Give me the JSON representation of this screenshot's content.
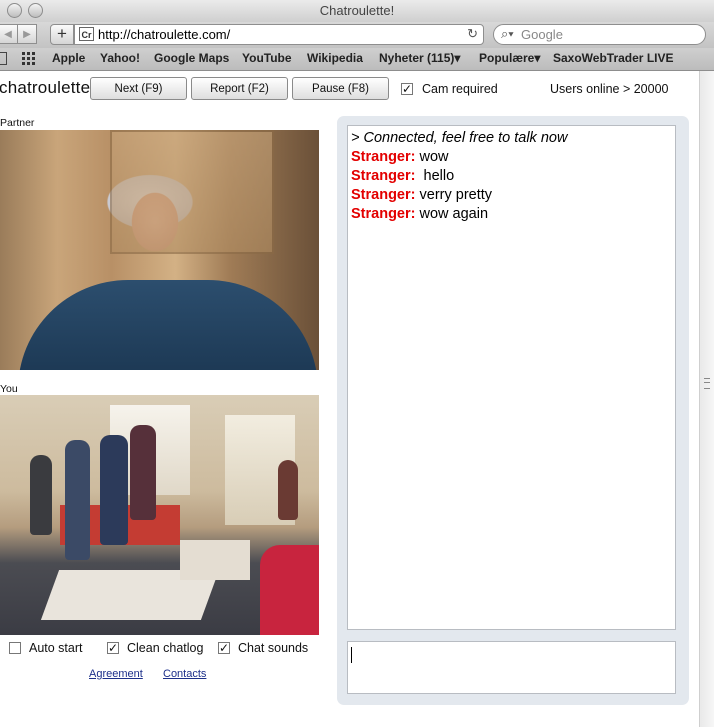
{
  "window": {
    "title": "Chatroulette!"
  },
  "browser": {
    "url": "http://chatroulette.com/",
    "favicon_text": "Cr",
    "search_placeholder": "Google",
    "bookmarks": [
      "Apple",
      "Yahoo!",
      "Google Maps",
      "YouTube",
      "Wikipedia",
      "Nyheter (115)▾",
      "Populære▾",
      "SaxoWebTrader LIVE"
    ]
  },
  "page": {
    "logo": "chatroulette",
    "buttons": {
      "next": "Next (F9)",
      "report": "Report (F2)",
      "pause": "Pause (F8)"
    },
    "cam_required_label": "Cam required",
    "cam_required_checked": true,
    "users_online": "Users online > 20000",
    "partner_label": "Partner",
    "you_label": "You",
    "options": [
      {
        "label": "Auto start",
        "checked": false
      },
      {
        "label": "Clean chatlog",
        "checked": true
      },
      {
        "label": "Chat sounds",
        "checked": true
      }
    ],
    "links": {
      "agreement": "Agreement",
      "contacts": "Contacts"
    }
  },
  "chat": {
    "system_message": "> Connected, feel free to talk now",
    "sender": "Stranger:",
    "messages": [
      "wow",
      " hello",
      "verry pretty",
      "wow again"
    ],
    "input_value": ""
  },
  "colors": {
    "stranger": "#e30000",
    "link": "#1c2f8a",
    "chat_panel": "#e3e8ee"
  },
  "icons": {
    "back": "back-arrow-icon",
    "forward": "forward-arrow-icon",
    "add": "plus-icon",
    "reload": "reload-icon",
    "search": "magnifier-icon",
    "checkmark": "check-icon"
  }
}
